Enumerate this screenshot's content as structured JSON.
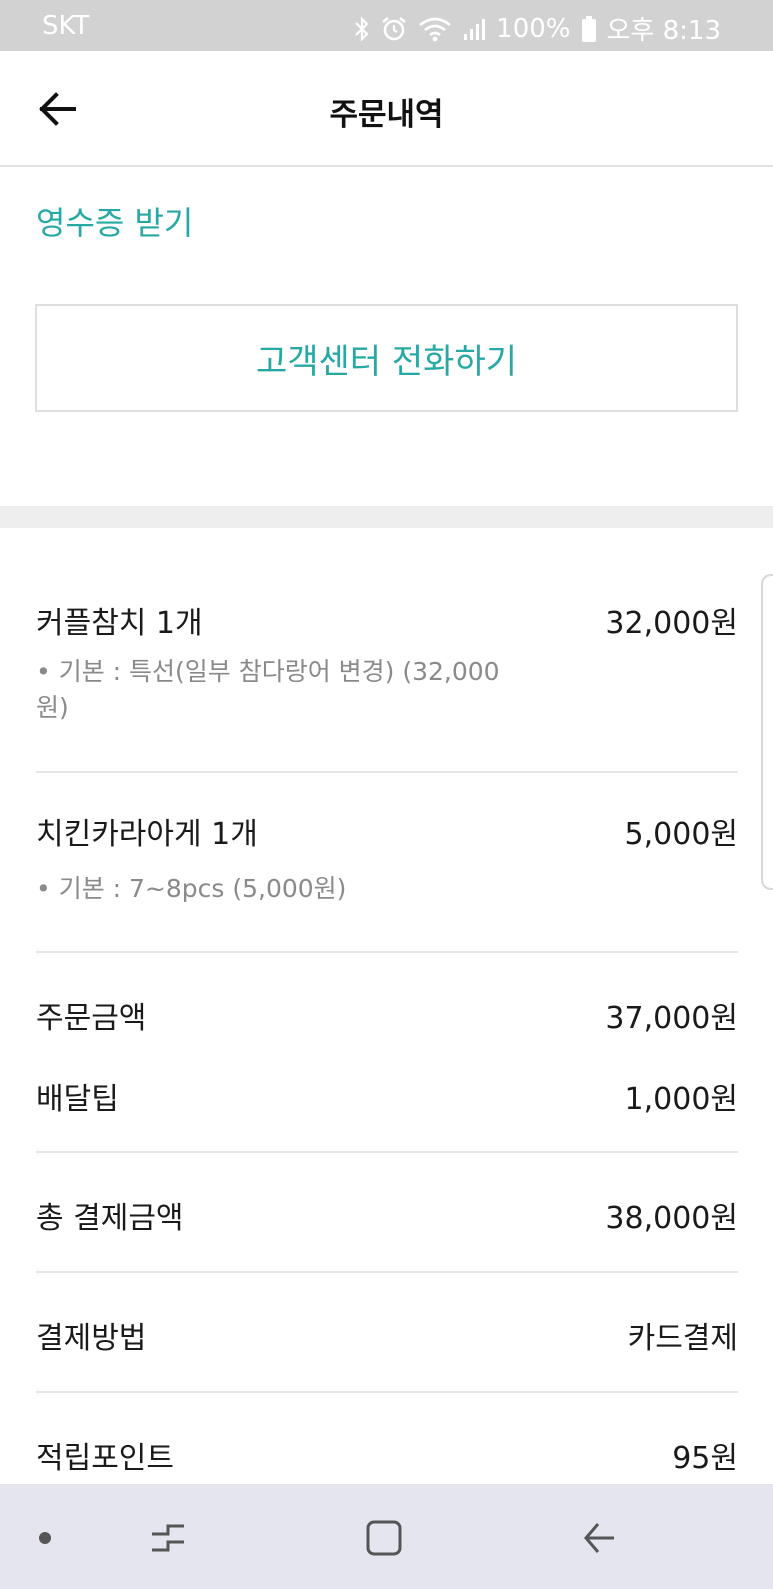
{
  "status_bar": {
    "carrier": "SKT",
    "battery": "100%",
    "time": "오후 8:13",
    "icons": [
      "bluetooth-icon",
      "alarm-icon",
      "wifi-icon",
      "signal-icon",
      "battery-icon"
    ]
  },
  "header": {
    "title": "주문내역",
    "back_icon": "back-arrow-icon"
  },
  "receipt_link": "영수증 받기",
  "call_button": "고객센터 전화하기",
  "order_items": [
    {
      "name": "커플참치 1개",
      "price": "32,000원",
      "option": "• 기본 : 특선(일부 참다랑어 변경) (32,000원)"
    },
    {
      "name": "치킨카라아게 1개",
      "price": "5,000원",
      "option": "• 기본 : 7~8pcs (5,000원)"
    }
  ],
  "summary": {
    "order_amount_label": "주문금액",
    "order_amount": "37,000원",
    "delivery_tip_label": "배달팁",
    "delivery_tip": "1,000원",
    "total_label": "총 결제금액",
    "total": "38,000원",
    "payment_method_label": "결제방법",
    "payment_method": "카드결제",
    "points_label": "적립포인트",
    "points": "95원"
  },
  "colors": {
    "accent": "#26a9a5",
    "status_bar": "#d2d2d2",
    "nav_bar": "#e4e5ef"
  },
  "nav_bar": {
    "icons": [
      "dot-icon",
      "recent-apps-icon",
      "home-icon",
      "back-icon"
    ]
  }
}
